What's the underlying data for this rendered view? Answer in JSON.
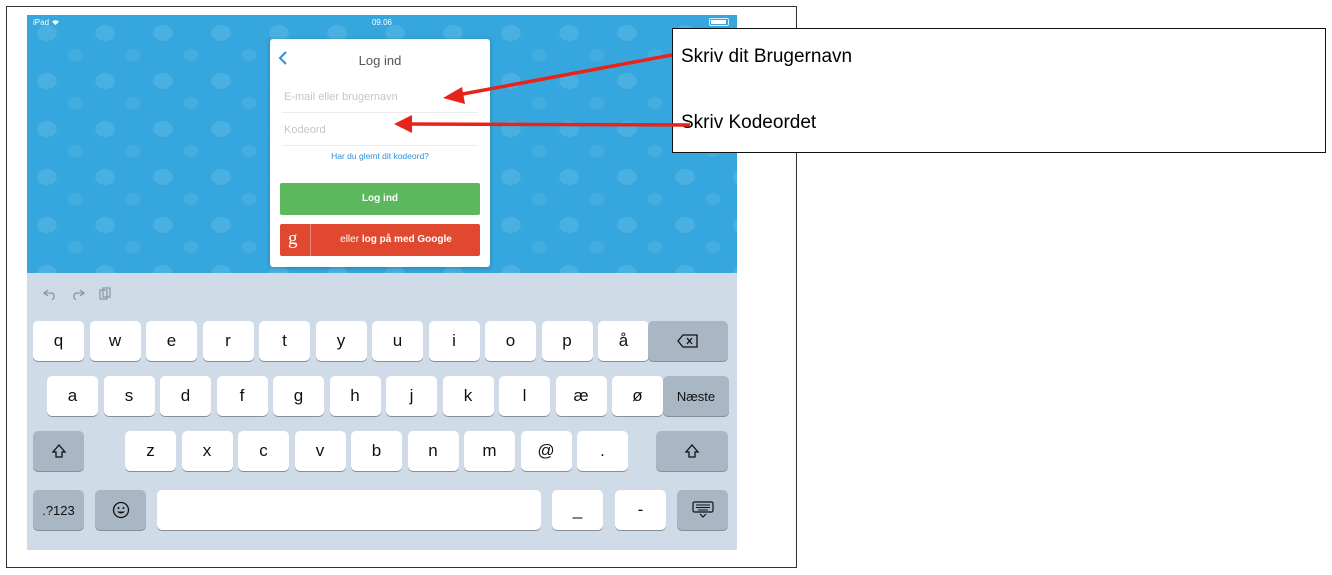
{
  "status_bar": {
    "device": "iPad",
    "wifi_icon": "wifi-icon",
    "time": "09.06",
    "battery_icon": "battery-icon"
  },
  "login": {
    "back_icon": "chevron-left-icon",
    "title": "Log ind",
    "email_placeholder": "E-mail eller brugernavn",
    "email_value": "",
    "password_placeholder": "Kodeord",
    "password_value": "",
    "forgot_link": "Har du glemt dit kodeord?",
    "login_button": "Log ind",
    "google_icon": "google-g-icon",
    "google_prefix": "eller",
    "google_bold": "log på med Google"
  },
  "keyboard": {
    "toolbar_icons": [
      "undo-icon",
      "redo-icon",
      "paste-icon"
    ],
    "row1": [
      "q",
      "w",
      "e",
      "r",
      "t",
      "y",
      "u",
      "i",
      "o",
      "p",
      "å"
    ],
    "row2": [
      "a",
      "s",
      "d",
      "f",
      "g",
      "h",
      "j",
      "k",
      "l",
      "æ",
      "ø"
    ],
    "row3": [
      "z",
      "x",
      "c",
      "v",
      "b",
      "n",
      "m",
      "@",
      "."
    ],
    "backspace_icon": "backspace-icon",
    "next_label": "Næste",
    "shift_icon": "shift-icon",
    "numbers_label": ".?123",
    "emoji_icon": "emoji-icon",
    "underscore": "_",
    "dash": "-",
    "hide_keyboard_icon": "keyboard-hide-icon"
  },
  "annotations": {
    "username_note": "Skriv dit Brugernavn",
    "password_note": "Skriv Kodeordet",
    "arrow_color": "#e8231a"
  },
  "colors": {
    "background_blue": "#35a7de",
    "login_green": "#5cb85c",
    "google_red": "#e0492f",
    "link_blue": "#2f8fd8"
  }
}
